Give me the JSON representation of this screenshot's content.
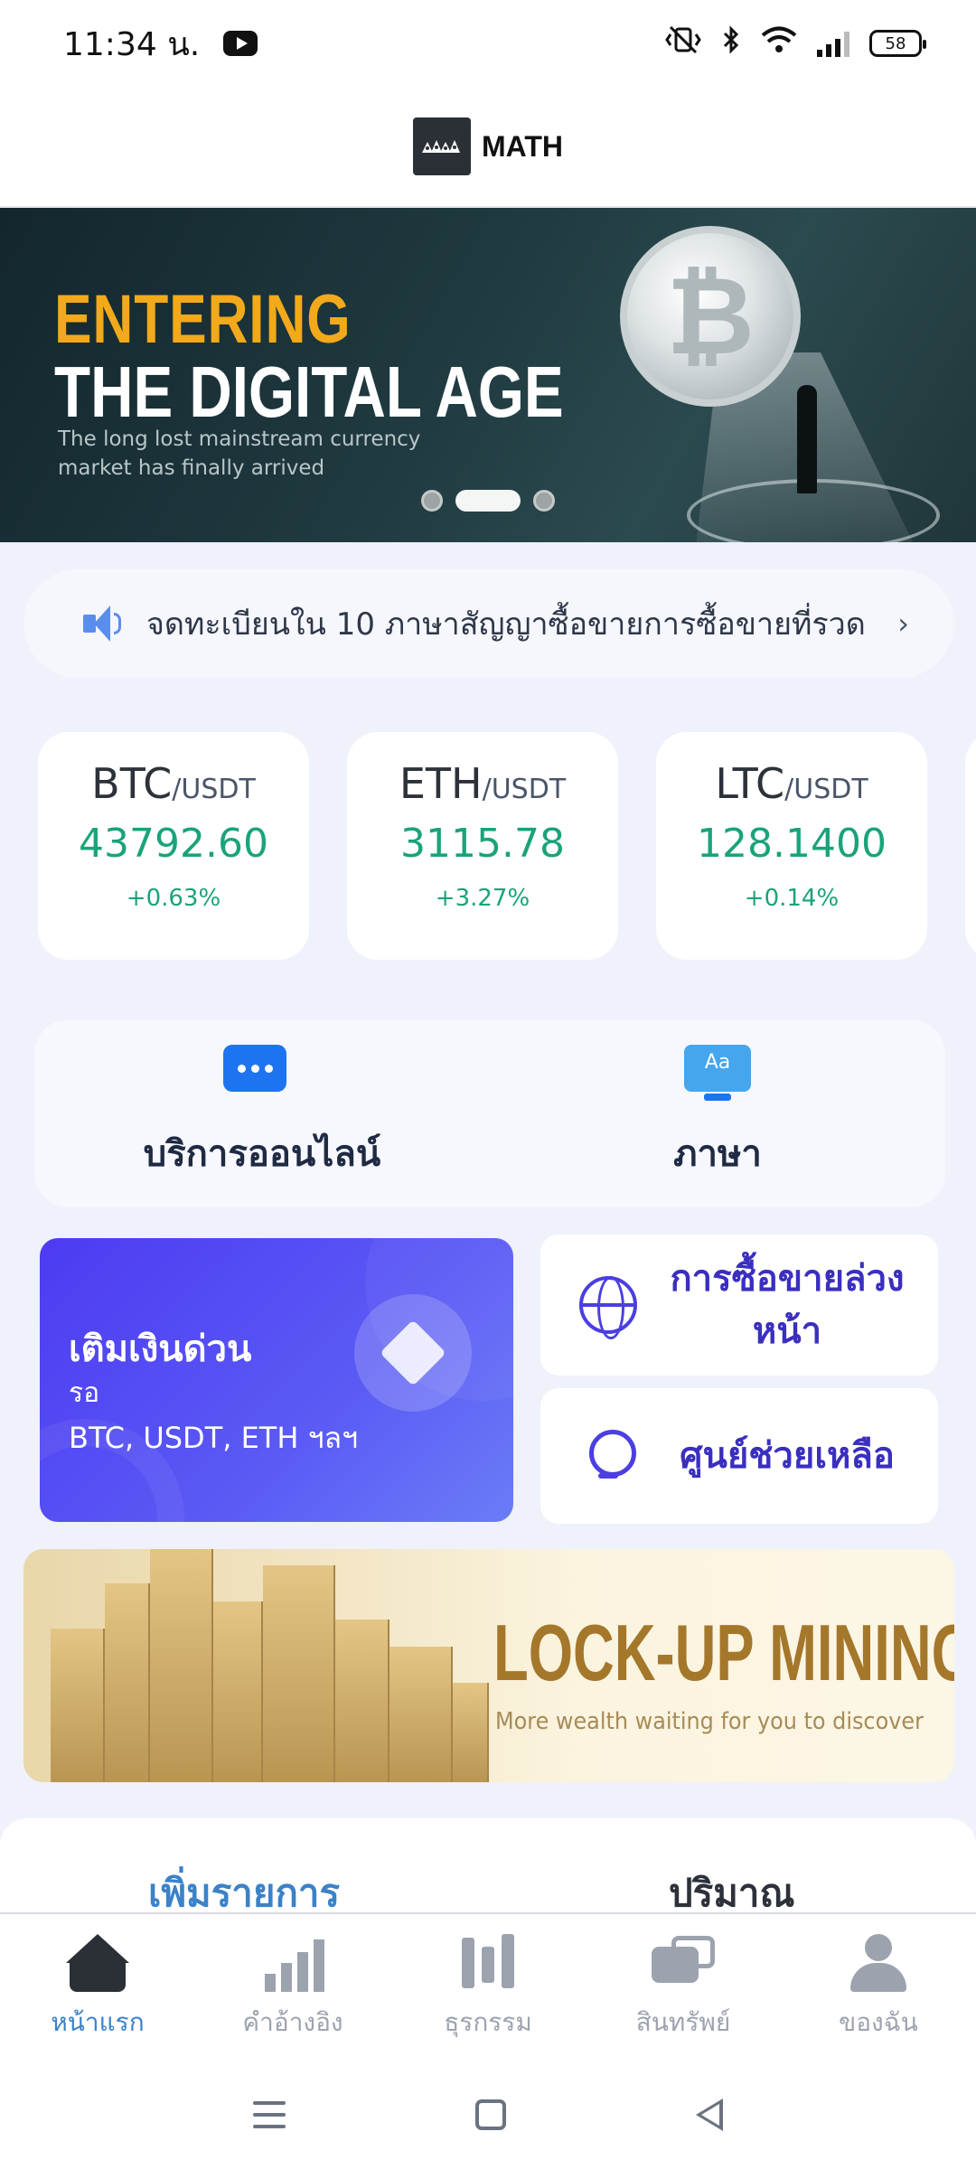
{
  "status_bar": {
    "time": "11:34 น.",
    "battery": "58"
  },
  "app": {
    "brand": "MATH"
  },
  "hero": {
    "line1": "ENTERING",
    "line2": "THE DIGITAL AGE",
    "tagline": "The long lost mainstream currency market has finally arrived",
    "coin_symbol": "₿",
    "slides": 3,
    "active_slide": 2
  },
  "notice": {
    "text": "จดทะเบียนใน 10 ภาษาสัญญาซื้อขายการซื้อขายที่รวด"
  },
  "tickers": [
    {
      "base": "BTC",
      "quote": "/USDT",
      "price": "43792.60",
      "change": "+0.63%"
    },
    {
      "base": "ETH",
      "quote": "/USDT",
      "price": "3115.78",
      "change": "+3.27%"
    },
    {
      "base": "LTC",
      "quote": "/USDT",
      "price": "128.1400",
      "change": "+0.14%"
    }
  ],
  "services": {
    "online_service": "บริการออนไลน์",
    "language": "ภาษา",
    "language_icon_text": "Aa"
  },
  "deposit": {
    "title": "เติมเงินด่วน",
    "subtitle": "รอ",
    "coins": "BTC, USDT, ETH ฯลฯ"
  },
  "quick_links": {
    "futures": "การซื้อขายล่วงหน้า",
    "help_center": "ศูนย์ช่วยเหลือ"
  },
  "lockup": {
    "title": "LOCK-UP MINING",
    "subtitle": "More wealth waiting for you to discover"
  },
  "list_tabs": {
    "add_item": "เพิ่มรายการ",
    "volume": "ปริมาณ"
  },
  "bottom_nav": [
    {
      "label": "หน้าแรก",
      "active": true
    },
    {
      "label": "คำอ้างอิง",
      "active": false
    },
    {
      "label": "ธุรกรรม",
      "active": false
    },
    {
      "label": "สินทรัพย์",
      "active": false
    },
    {
      "label": "ของฉัน",
      "active": false
    }
  ],
  "colors": {
    "positive": "#1aa37a",
    "accent_blue": "#3b82c8",
    "deposit_gradient_start": "#4d3bf2",
    "link_purple": "#3a2fbf",
    "hero_gold": "#f2a91b"
  }
}
